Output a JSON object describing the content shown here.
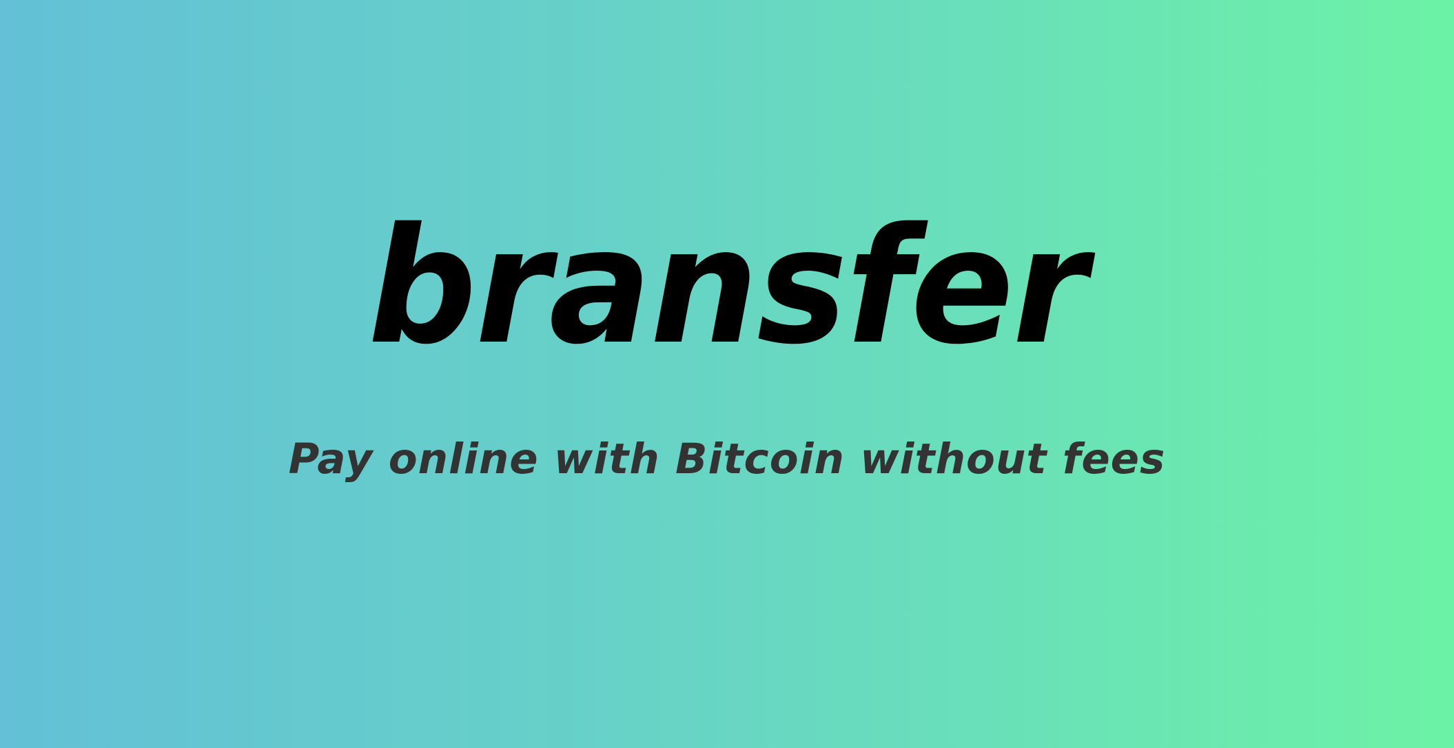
{
  "brand": {
    "logo_text": "bransfer",
    "tagline": "Pay online with Bitcoin without fees"
  },
  "colors": {
    "gradient_start": "#63c0d6",
    "gradient_end": "#6cf2a6",
    "logo": "#000000",
    "tagline": "#333333"
  }
}
